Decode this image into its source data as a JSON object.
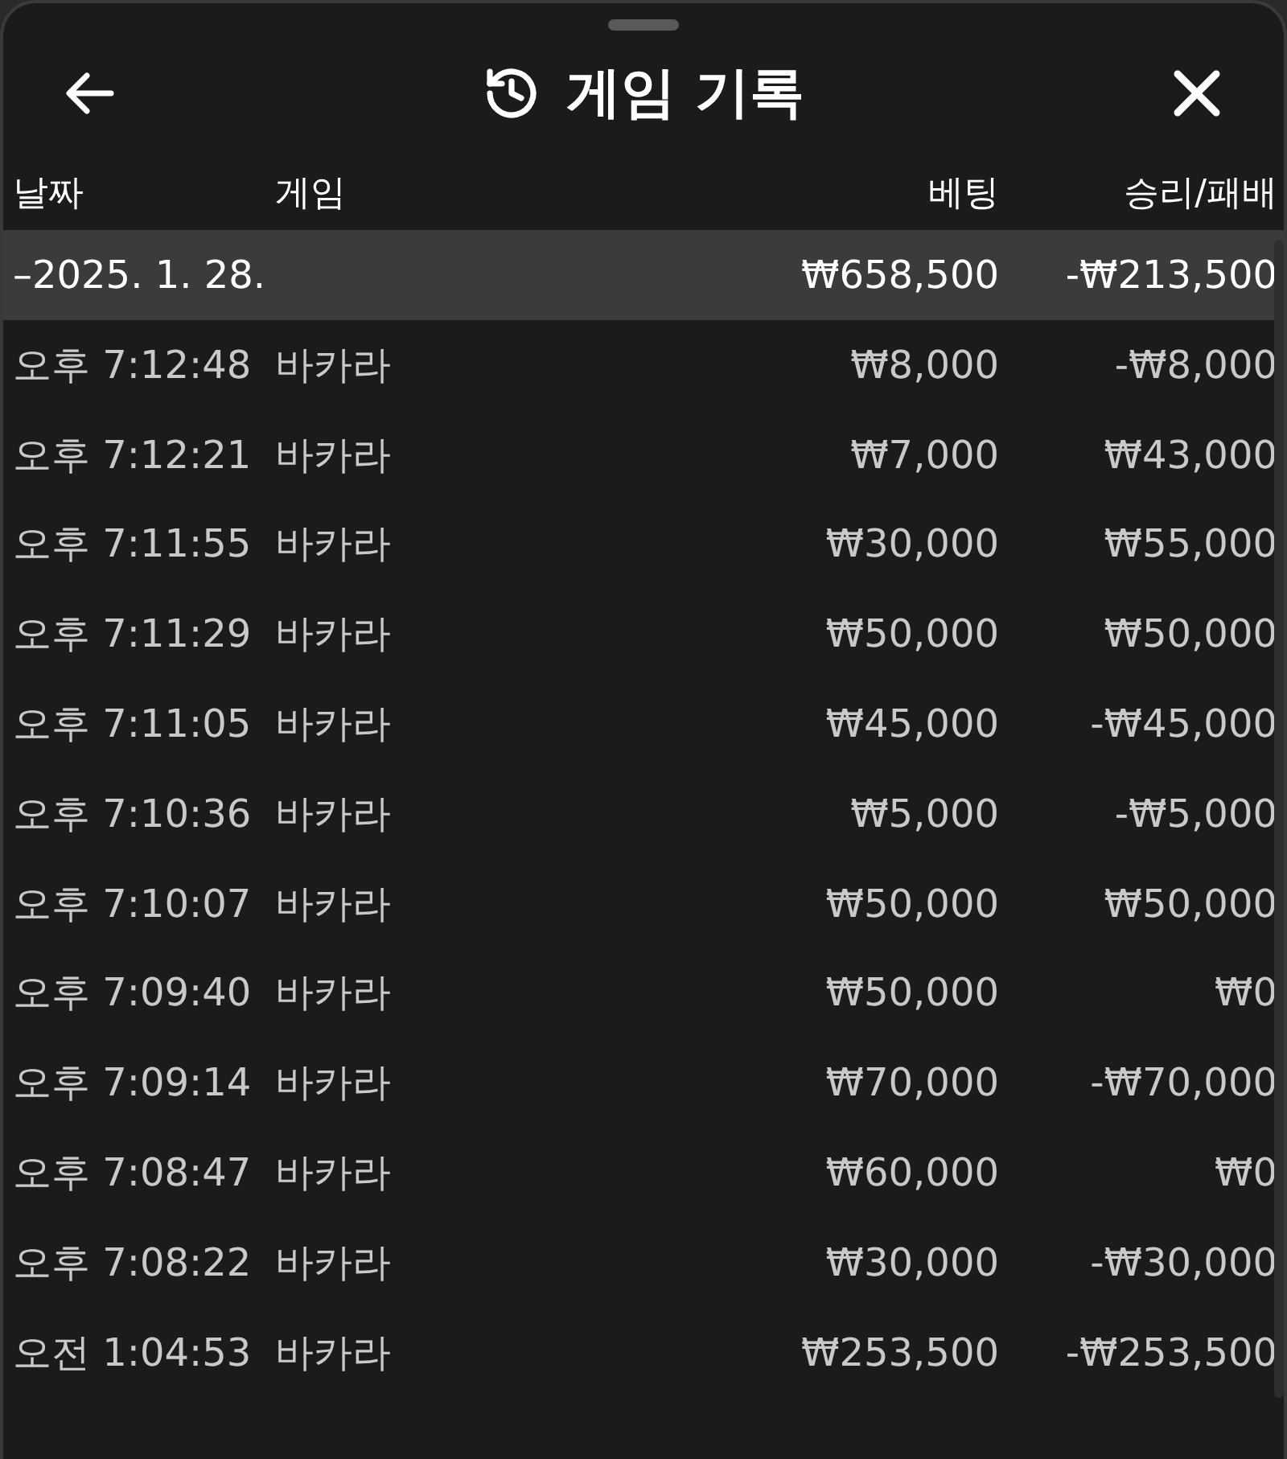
{
  "header": {
    "title": "게임 기록"
  },
  "table": {
    "columns": [
      "날짜",
      "게임",
      "베팅",
      "승리/패배"
    ],
    "group": {
      "date": "–2025. 1. 28.",
      "bet": "₩658,500",
      "result": "-₩213,500"
    },
    "rows": [
      {
        "time": "오후 7:12:48",
        "game": "바카라",
        "bet": "₩8,000",
        "result": "-₩8,000"
      },
      {
        "time": "오후 7:12:21",
        "game": "바카라",
        "bet": "₩7,000",
        "result": "₩43,000"
      },
      {
        "time": "오후 7:11:55",
        "game": "바카라",
        "bet": "₩30,000",
        "result": "₩55,000"
      },
      {
        "time": "오후 7:11:29",
        "game": "바카라",
        "bet": "₩50,000",
        "result": "₩50,000"
      },
      {
        "time": "오후 7:11:05",
        "game": "바카라",
        "bet": "₩45,000",
        "result": "-₩45,000"
      },
      {
        "time": "오후 7:10:36",
        "game": "바카라",
        "bet": "₩5,000",
        "result": "-₩5,000"
      },
      {
        "time": "오후 7:10:07",
        "game": "바카라",
        "bet": "₩50,000",
        "result": "₩50,000"
      },
      {
        "time": "오후 7:09:40",
        "game": "바카라",
        "bet": "₩50,000",
        "result": "₩0"
      },
      {
        "time": "오후 7:09:14",
        "game": "바카라",
        "bet": "₩70,000",
        "result": "-₩70,000"
      },
      {
        "time": "오후 7:08:47",
        "game": "바카라",
        "bet": "₩60,000",
        "result": "₩0"
      },
      {
        "time": "오후 7:08:22",
        "game": "바카라",
        "bet": "₩30,000",
        "result": "-₩30,000"
      },
      {
        "time": "오전 1:04:53",
        "game": "바카라",
        "bet": "₩253,500",
        "result": "-₩253,500"
      }
    ]
  }
}
